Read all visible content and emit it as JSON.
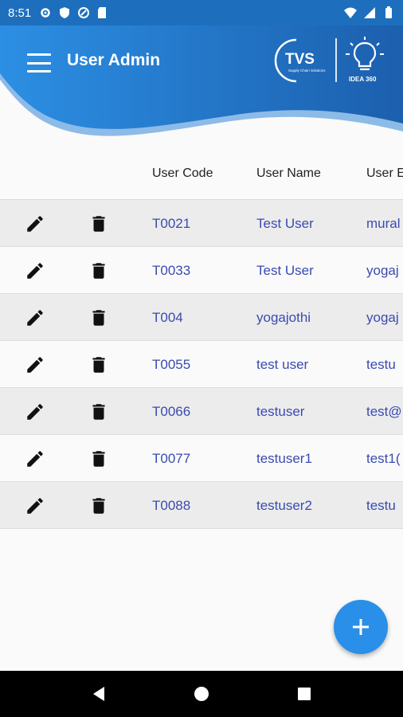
{
  "status_bar": {
    "time": "8:51"
  },
  "header": {
    "title": "User Admin",
    "logo_text": "TVS",
    "logo_subtext": "Supply Chain Solutions",
    "idea_text": "IDEA 360"
  },
  "table": {
    "columns": [
      "User Code",
      "User Name",
      "User E"
    ],
    "rows": [
      {
        "code": "T0021",
        "name": "Test User",
        "email": "mural"
      },
      {
        "code": "T0033",
        "name": "Test User",
        "email": "yogaj"
      },
      {
        "code": "T004",
        "name": "yogajothi",
        "email": "yogaj"
      },
      {
        "code": "T0055",
        "name": "test user",
        "email": "testu"
      },
      {
        "code": "T0066",
        "name": "testuser",
        "email": "test@"
      },
      {
        "code": "T0077",
        "name": "testuser1",
        "email": "test1("
      },
      {
        "code": "T0088",
        "name": "testuser2",
        "email": "testu"
      }
    ]
  },
  "colors": {
    "accent": "#2a8fe8",
    "header_dark": "#1d6fbd",
    "link_text": "#3a4bb0"
  },
  "icons": {
    "edit": "pencil-icon",
    "delete": "trash-icon",
    "fab": "plus-icon",
    "menu": "hamburger-icon"
  }
}
